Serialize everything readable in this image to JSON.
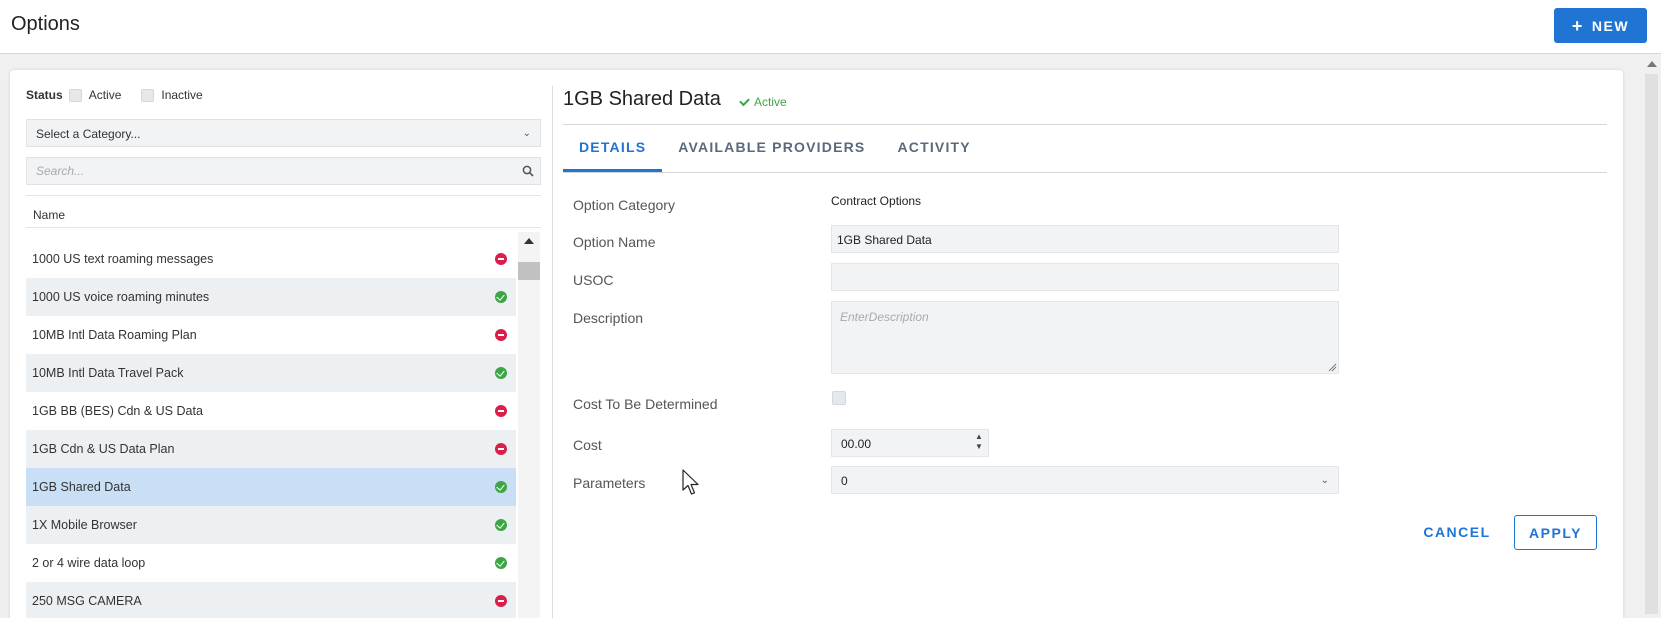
{
  "header": {
    "title": "Options",
    "new_label": "NEW"
  },
  "filters": {
    "status_label": "Status",
    "active_label": "Active",
    "inactive_label": "Inactive",
    "category_placeholder": "Select a Category...",
    "search_placeholder": "Search..."
  },
  "list": {
    "column_header": "Name",
    "items": [
      {
        "name": "1000 US text roaming messages",
        "status": "inactive"
      },
      {
        "name": "1000 US voice roaming minutes",
        "status": "active"
      },
      {
        "name": "10MB Intl Data Roaming Plan",
        "status": "inactive"
      },
      {
        "name": "10MB Intl Data Travel Pack",
        "status": "active"
      },
      {
        "name": "1GB BB (BES) Cdn & US Data",
        "status": "inactive"
      },
      {
        "name": "1GB Cdn & US Data Plan",
        "status": "inactive"
      },
      {
        "name": "1GB Shared Data",
        "status": "active",
        "selected": true
      },
      {
        "name": "1X Mobile Browser",
        "status": "active"
      },
      {
        "name": "2 or 4 wire data loop",
        "status": "active"
      },
      {
        "name": "250 MSG CAMERA",
        "status": "inactive"
      }
    ]
  },
  "detail": {
    "title": "1GB Shared Data",
    "status": "Active",
    "tabs": [
      {
        "label": "DETAILS",
        "active": true
      },
      {
        "label": "AVAILABLE PROVIDERS",
        "active": false
      },
      {
        "label": "ACTIVITY",
        "active": false
      }
    ],
    "fields": {
      "category_label": "Option Category",
      "category_value": "Contract Options",
      "name_label": "Option Name",
      "name_value": "1GB Shared Data",
      "usoc_label": "USOC",
      "usoc_value": "",
      "description_label": "Description",
      "description_placeholder": "EnterDescription",
      "cost_tbd_label": "Cost To Be Determined",
      "cost_label": "Cost",
      "cost_value": "00.00",
      "parameters_label": "Parameters",
      "parameters_value": "0"
    },
    "cancel_label": "CANCEL",
    "apply_label": "APPLY"
  },
  "colors": {
    "accent": "#1f74d4",
    "active": "#3da644",
    "inactive": "#dc1e4b",
    "selected_row": "#c9dff5"
  }
}
